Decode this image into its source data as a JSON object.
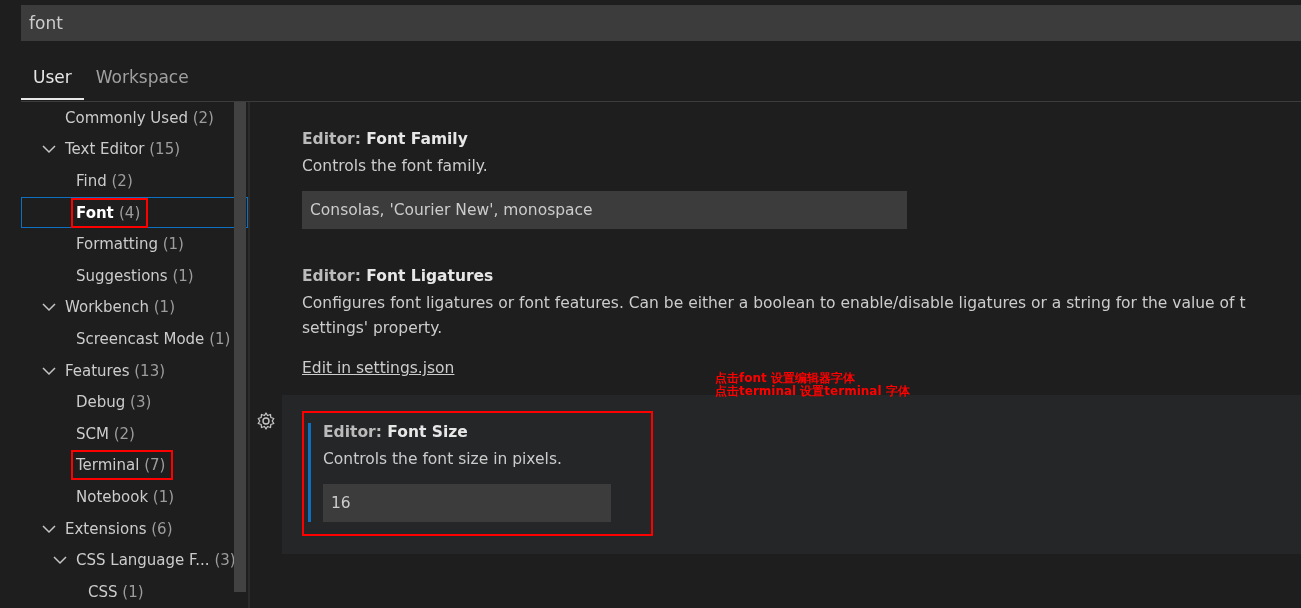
{
  "search": {
    "value": "font"
  },
  "tabs": [
    {
      "label": "User",
      "selected": true
    },
    {
      "label": "Workspace",
      "selected": false
    }
  ],
  "tree": [
    {
      "label": "Commonly Used",
      "count": "(2)",
      "selected": false,
      "highlighted": false
    },
    {
      "label": "Text Editor",
      "count": "(15)",
      "expanded": true,
      "selected": false,
      "highlighted": false,
      "children": [
        {
          "label": "Find",
          "count": "(2)",
          "selected": false,
          "highlighted": false
        },
        {
          "label": "Font",
          "count": "(4)",
          "selected": true,
          "highlighted": true
        },
        {
          "label": "Formatting",
          "count": "(1)",
          "selected": false,
          "highlighted": false
        },
        {
          "label": "Suggestions",
          "count": "(1)",
          "selected": false,
          "highlighted": false
        }
      ]
    },
    {
      "label": "Workbench",
      "count": "(1)",
      "expanded": true,
      "selected": false,
      "highlighted": false,
      "children": [
        {
          "label": "Screencast Mode",
          "count": "(1)",
          "selected": false,
          "highlighted": false
        }
      ]
    },
    {
      "label": "Features",
      "count": "(13)",
      "expanded": true,
      "selected": false,
      "highlighted": false,
      "children": [
        {
          "label": "Debug",
          "count": "(3)",
          "selected": false,
          "highlighted": false
        },
        {
          "label": "SCM",
          "count": "(2)",
          "selected": false,
          "highlighted": false
        },
        {
          "label": "Terminal",
          "count": "(7)",
          "selected": false,
          "highlighted": true
        },
        {
          "label": "Notebook",
          "count": "(1)",
          "selected": false,
          "highlighted": false
        }
      ]
    },
    {
      "label": "Extensions",
      "count": "(6)",
      "expanded": true,
      "selected": false,
      "highlighted": false,
      "children": [
        {
          "label": "CSS Language F...",
          "count": "(3)",
          "expanded": true,
          "selected": false,
          "highlighted": false,
          "children": [
            {
              "label": "CSS",
              "count": "(1)",
              "selected": false,
              "highlighted": false
            }
          ]
        }
      ]
    }
  ],
  "settings": [
    {
      "kind": "text",
      "category": "Editor:",
      "name": "Font Family",
      "description_lines": [
        "Controls the font family."
      ],
      "value": "Consolas, 'Courier New', monospace",
      "focused": false,
      "highlighted": false
    },
    {
      "kind": "link",
      "category": "Editor:",
      "name": "Font Ligatures",
      "description_lines": [
        "Configures font ligatures or font features. Can be either a boolean to enable/disable ligatures or a string for the value of t",
        "settings' property."
      ],
      "link": "Edit in settings.json",
      "focused": false,
      "highlighted": false
    },
    {
      "kind": "text",
      "category": "Editor:",
      "name": "Font Size",
      "description_lines": [
        "Controls the font size in pixels."
      ],
      "value": "16",
      "focused": true,
      "highlighted": true
    }
  ],
  "annotation": {
    "lines": [
      "点击font 设置编辑器字体",
      "点击terminal 设置terminal 字体"
    ]
  }
}
